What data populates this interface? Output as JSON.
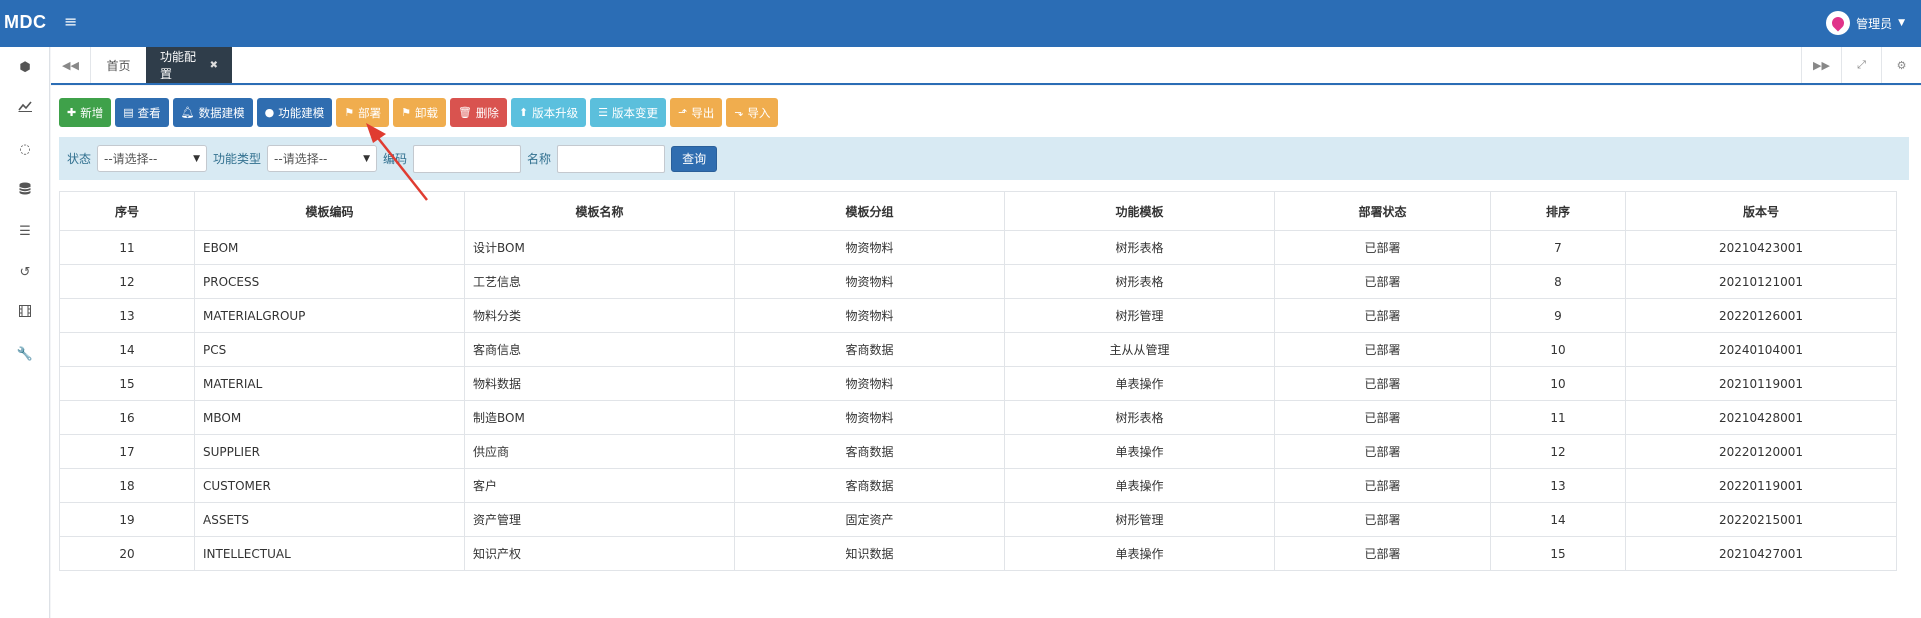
{
  "app": {
    "logo": "MDC",
    "menu_icon": "hamburger-icon"
  },
  "user": {
    "name": "管理员",
    "avatar_color": "#e0338a"
  },
  "sidebar": {
    "items": [
      {
        "icon": "cube-icon"
      },
      {
        "icon": "chart-line-icon"
      },
      {
        "icon": "spinner-icon"
      },
      {
        "icon": "database-icon"
      },
      {
        "icon": "list-icon"
      },
      {
        "icon": "history-icon"
      },
      {
        "icon": "film-icon"
      },
      {
        "icon": "wrench-icon"
      }
    ]
  },
  "tabs": {
    "home": "首页",
    "active": "功能配置"
  },
  "toolbar": {
    "buttons": [
      {
        "label": "新增",
        "icon": "plus-icon",
        "color": "#3fa14a"
      },
      {
        "label": "查看",
        "icon": "table-icon",
        "color": "#2f6db0"
      },
      {
        "label": "数据建模",
        "icon": "bell-icon",
        "color": "#2f6db0"
      },
      {
        "label": "功能建模",
        "icon": "bulb-icon",
        "color": "#2f6db0"
      },
      {
        "label": "部署",
        "icon": "deploy-icon",
        "color": "#f0ad4e"
      },
      {
        "label": "卸载",
        "icon": "uninstall-icon",
        "color": "#f0ad4e"
      },
      {
        "label": "删除",
        "icon": "trash-icon",
        "color": "#d9534f"
      },
      {
        "label": "版本升级",
        "icon": "upload-icon",
        "color": "#5bc0de"
      },
      {
        "label": "版本变更",
        "icon": "list-icon",
        "color": "#5bbfdc"
      },
      {
        "label": "导出",
        "icon": "export-icon",
        "color": "#f0ad4e"
      },
      {
        "label": "导入",
        "icon": "import-icon",
        "color": "#f0ad4e"
      }
    ]
  },
  "search": {
    "status_label": "状态",
    "status_value": "--请选择--",
    "type_label": "功能类型",
    "type_value": "--请选择--",
    "code_label": "编码",
    "name_label": "名称",
    "query_label": "查询"
  },
  "table": {
    "columns": [
      "序号",
      "模板编码",
      "模板名称",
      "模板分组",
      "功能模板",
      "部署状态",
      "排序",
      "版本号"
    ],
    "rows": [
      [
        "11",
        "EBOM",
        "设计BOM",
        "物资物料",
        "树形表格",
        "已部署",
        "7",
        "20210423001"
      ],
      [
        "12",
        "PROCESS",
        "工艺信息",
        "物资物料",
        "树形表格",
        "已部署",
        "8",
        "20210121001"
      ],
      [
        "13",
        "MATERIALGROUP",
        "物料分类",
        "物资物料",
        "树形管理",
        "已部署",
        "9",
        "20220126001"
      ],
      [
        "14",
        "PCS",
        "客商信息",
        "客商数据",
        "主从从管理",
        "已部署",
        "10",
        "20240104001"
      ],
      [
        "15",
        "MATERIAL",
        "物料数据",
        "物资物料",
        "单表操作",
        "已部署",
        "10",
        "20210119001"
      ],
      [
        "16",
        "MBOM",
        "制造BOM",
        "物资物料",
        "树形表格",
        "已部署",
        "11",
        "20210428001"
      ],
      [
        "17",
        "SUPPLIER",
        "供应商",
        "客商数据",
        "单表操作",
        "已部署",
        "12",
        "20220120001"
      ],
      [
        "18",
        "CUSTOMER",
        "客户",
        "客商数据",
        "单表操作",
        "已部署",
        "13",
        "20220119001"
      ],
      [
        "19",
        "ASSETS",
        "资产管理",
        "固定资产",
        "树形管理",
        "已部署",
        "14",
        "20220215001"
      ],
      [
        "20",
        "INTELLECTUAL",
        "知识产权",
        "知识数据",
        "单表操作",
        "已部署",
        "15",
        "20210427001"
      ]
    ]
  },
  "annotation": {
    "color": "#e03c31"
  }
}
